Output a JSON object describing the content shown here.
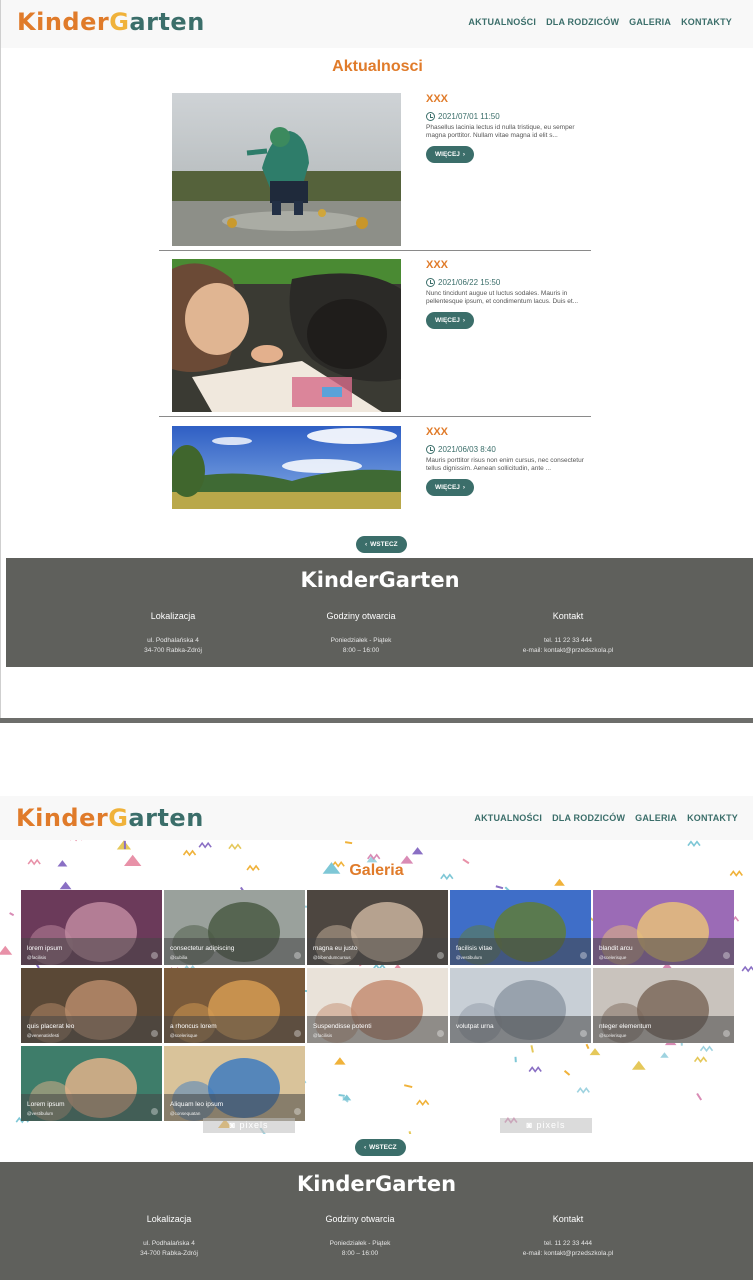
{
  "brand": {
    "logo_part1": "Kinder",
    "logo_part2": "G",
    "logo_part3": "arten",
    "footer_logo": "KinderGarten"
  },
  "nav": [
    "AKTUALNOŚCI",
    "DLA RODZICÓW",
    "GALERIA",
    "KONTAKTY"
  ],
  "news_page": {
    "title": "Aktualnosci",
    "items": [
      {
        "title": "XXX",
        "date": "2021/07/01 11:50",
        "excerpt": "Phasellus lacinia lectus id nulla tristique, eu semper magna porttitor. Nullam vitae magna id elit s...",
        "button": "WIĘCEJ",
        "image": "child-in-puddle-photo"
      },
      {
        "title": "XXX",
        "date": "2021/06/22 15:50",
        "excerpt": "Nunc tincidunt augue ut luctus sodales. Mauris in pellentesque ipsum, et condimentum lacus. Duis et...",
        "button": "WIĘCEJ",
        "image": "children-drawing-photo"
      },
      {
        "title": "XXX",
        "date": "2021/06/03 8:40",
        "excerpt": "Mauris porttitor risus non enim cursus, nec consectetur tellus dignissim. Aenean sollicitudin, ante ...",
        "button": "WIĘCEJ",
        "image": "meadow-landscape-photo"
      }
    ],
    "back_button": "WSTECZ"
  },
  "footer": {
    "columns": [
      {
        "title": "Lokalizacja",
        "lines": [
          "ul. Podhalańska 4",
          "34-700 Rabka-Zdrój"
        ]
      },
      {
        "title": "Godziny otwarcia",
        "lines": [
          "Poniedziałek - Piątek",
          "8:00 – 16:00"
        ]
      },
      {
        "title": "Kontakt",
        "lines": [
          "tel. 11 22 33 444",
          "e-mail: kontakt@przedszkola.pl"
        ]
      }
    ]
  },
  "gallery_page": {
    "title": "Galeria",
    "tiles": [
      {
        "caption": "lorem ipsum",
        "credit": "@facilisis"
      },
      {
        "caption": "consectetur adipiscing",
        "credit": "@cubilia"
      },
      {
        "caption": "magna eu justo",
        "credit": "@bibendumcursus"
      },
      {
        "caption": "facilisis vitae",
        "credit": "@vestibulum"
      },
      {
        "caption": "blandit arcu",
        "credit": "@scelerisque"
      },
      {
        "caption": "quis placerat leo",
        "credit": "@venenatisfesti"
      },
      {
        "caption": "a rhoncus lorem",
        "credit": "@scelerisque"
      },
      {
        "caption": "Suspendisse potenti",
        "credit": "@facilisis"
      },
      {
        "caption": "volutpat urna",
        "credit": ""
      },
      {
        "caption": "nteger elementum",
        "credit": "@scelerisque"
      },
      {
        "caption": "Lorem ipsum",
        "credit": "@vestibulum"
      },
      {
        "caption": "Aliquam leo ipsum",
        "credit": "@consequatan"
      }
    ],
    "watermark": "pixels",
    "back_button": "WSTECZ"
  }
}
